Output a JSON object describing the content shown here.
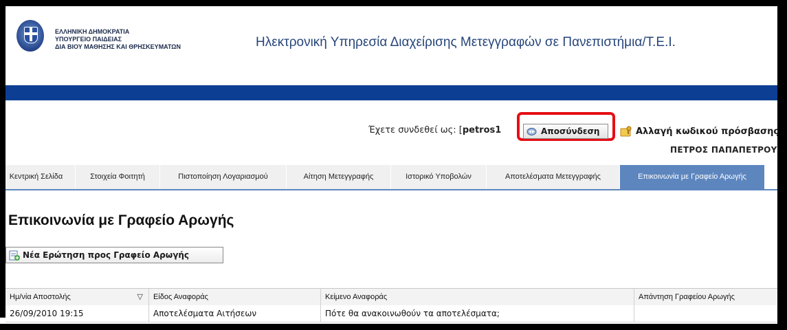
{
  "header": {
    "ministry_lines": [
      "ΕΛΛΗΝΙΚΗ ΔΗΜΟΚΡΑΤΙΑ",
      "ΥΠΟΥΡΓΕΙΟ ΠΑΙΔΕΙΑΣ",
      "ΔΙΑ ΒΙΟΥ ΜΑΘΗΣΗΣ ΚΑΙ ΘΡΗΣΚΕΥΜΑΤΩΝ"
    ],
    "site_title": "Ηλεκτρονική Υπηρεσία Διαχείρισης Μετεγγραφών σε Πανεπιστήμια/Τ.Ε.Ι."
  },
  "user": {
    "logged_in_prefix": "Έχετε συνδεθεί ως: [",
    "username": "petros1",
    "logout_label": "Αποσύνδεση",
    "change_password_label": "Αλλαγή κωδικού πρόσβασης",
    "full_name": "ΠΕΤΡΟΣ ΠΑΠΑΠΕΤΡΟΥ"
  },
  "tabs": [
    {
      "label": "Κεντρική Σελίδα",
      "active": false
    },
    {
      "label": "Στοιχεία Φοιτητή",
      "active": false
    },
    {
      "label": "Πιστοποίηση Λογαριασμού",
      "active": false
    },
    {
      "label": "Αίτηση Μετεγγραφής",
      "active": false
    },
    {
      "label": "Ιστορικό Υποβολών",
      "active": false
    },
    {
      "label": "Αποτελέσματα Μετεγγραφής",
      "active": false
    },
    {
      "label": "Επικοινωνία με Γραφείο Αρωγής",
      "active": true
    }
  ],
  "main": {
    "page_title": "Επικοινωνία με Γραφείο Αρωγής",
    "new_question_label": "Νέα Ερώτηση προς Γραφείο Αρωγής"
  },
  "table": {
    "columns": [
      "Ημ/νία Αποστολής",
      "Είδος Αναφοράς",
      "Κείμενο Αναφοράς",
      "Απάντηση Γραφείου Αρωγής"
    ],
    "rows": [
      [
        "26/09/2010 19:15",
        "Αποτελέσματα Αιτήσεων",
        "Πότε θα ανακοινωθούν τα αποτελέσματα;",
        ""
      ]
    ]
  },
  "colors": {
    "accent_blue": "#0c3f93",
    "active_tab": "#5d86bf",
    "highlight_red": "#e60e15"
  }
}
